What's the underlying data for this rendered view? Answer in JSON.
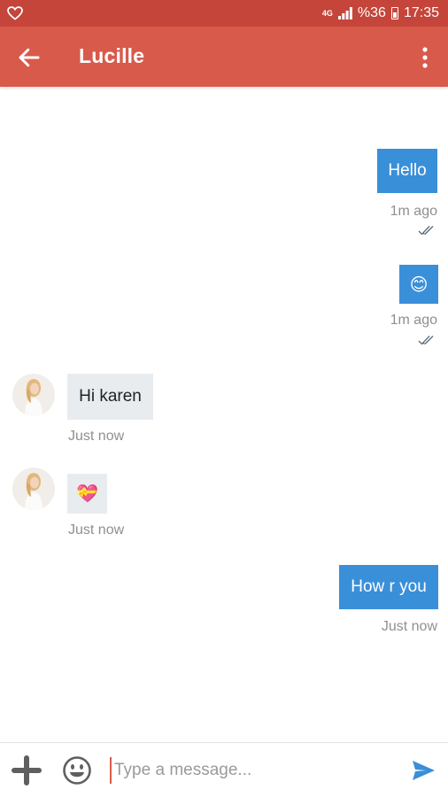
{
  "status_bar": {
    "network": "4G",
    "battery": "%36",
    "time": "17:35",
    "icons": [
      "heart-icon",
      "signal-icon",
      "battery-icon"
    ]
  },
  "header": {
    "title": "Lucille",
    "back_icon": "arrow-left-icon",
    "menu_icon": "more-vertical-icon"
  },
  "messages": [
    {
      "direction": "outgoing",
      "text": "Hello",
      "time": "1m ago",
      "read": true
    },
    {
      "direction": "outgoing",
      "emoji": "😊",
      "time": "1m ago",
      "read": true
    },
    {
      "direction": "incoming",
      "text": "Hi karen",
      "time": "Just now"
    },
    {
      "direction": "incoming",
      "emoji": "💝",
      "time": "Just now"
    },
    {
      "direction": "outgoing",
      "text": "How r you",
      "time": "Just now"
    }
  ],
  "composer": {
    "placeholder": "Type a message...",
    "add_icon": "plus-icon",
    "emoji_icon": "smiley-icon",
    "send_icon": "send-icon"
  },
  "colors": {
    "status_bar": "#c5453a",
    "app_bar": "#d85a4b",
    "outgoing_bubble": "#3a8fd9",
    "incoming_bubble": "#e8ecef",
    "send_icon": "#3a8fd9"
  }
}
